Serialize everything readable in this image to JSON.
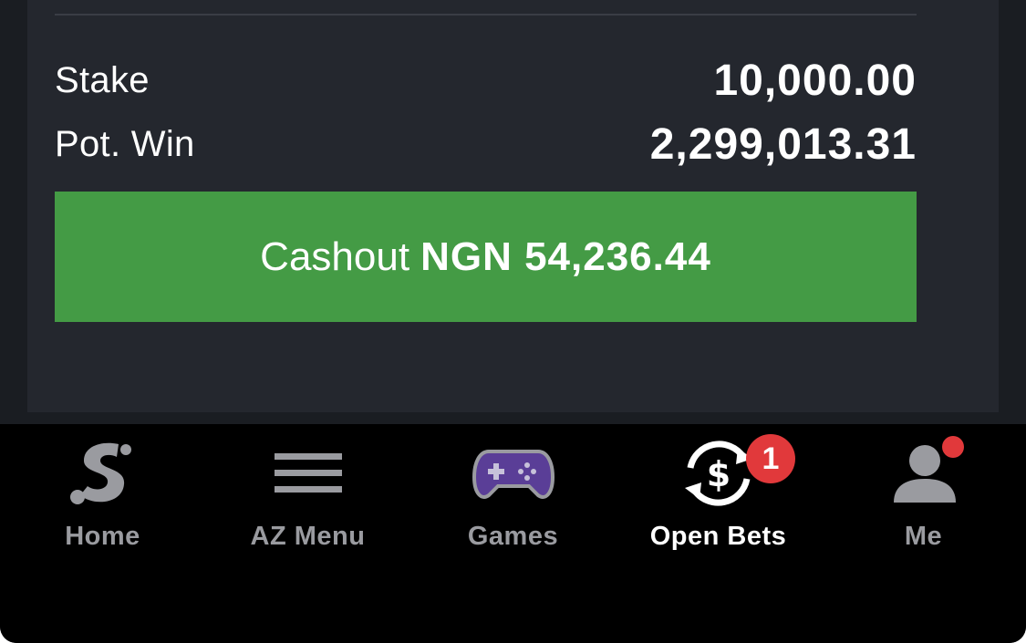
{
  "betslip": {
    "stake_label": "Stake",
    "stake_value": "10,000.00",
    "potwin_label": "Pot. Win",
    "potwin_value": "2,299,013.31",
    "cashout_word": "Cashout",
    "cashout_amount": "NGN 54,236.44",
    "cashout_color": "#449b45"
  },
  "tabbar": {
    "items": [
      {
        "label": "Home",
        "icon": "sportybet-logo-icon",
        "active": false
      },
      {
        "label": "AZ Menu",
        "icon": "hamburger-menu-icon",
        "active": false
      },
      {
        "label": "Games",
        "icon": "gamepad-icon",
        "active": false
      },
      {
        "label": "Open Bets",
        "icon": "cashout-dollar-icon",
        "active": true,
        "badge": "1"
      },
      {
        "label": "Me",
        "icon": "user-icon",
        "active": false,
        "notification_dot": true
      }
    ],
    "active_color": "#ffffff",
    "inactive_color": "#9a9ba0",
    "badge_color": "#e1393b"
  }
}
